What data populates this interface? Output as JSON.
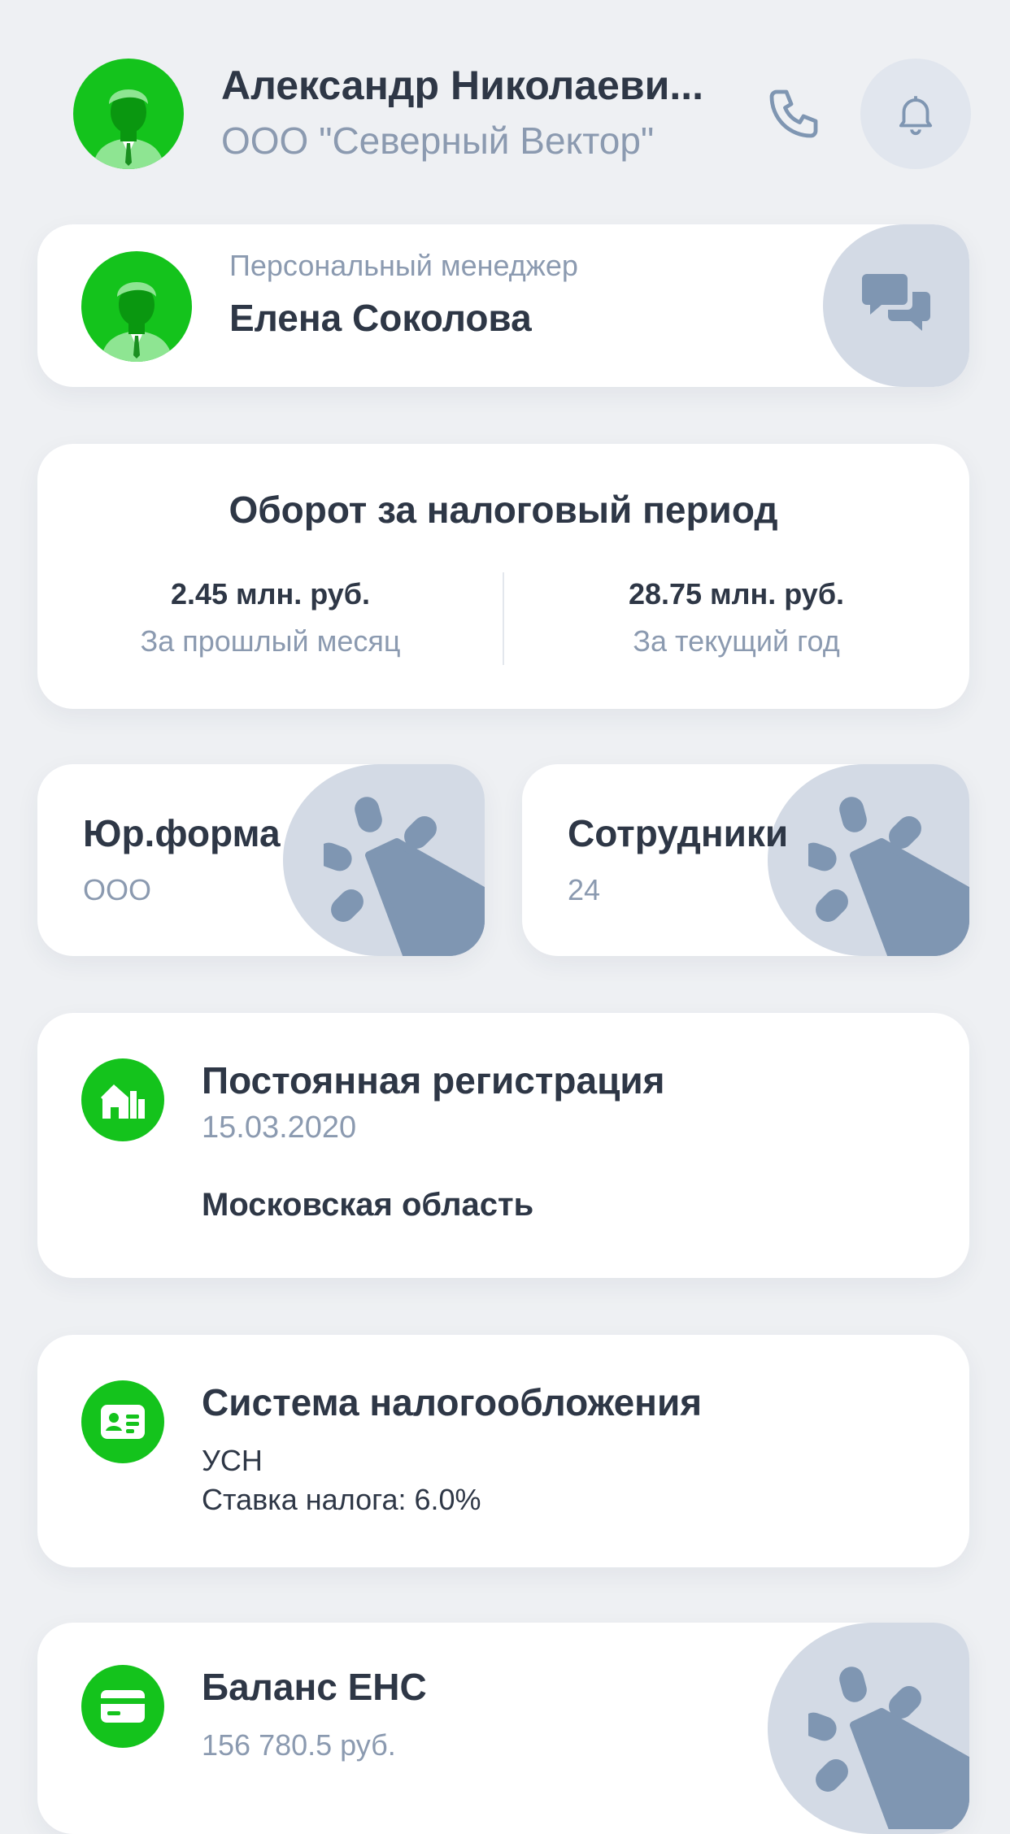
{
  "header": {
    "user_name": "Александр Николаеви...",
    "company": "ООО \"Северный Вектор\""
  },
  "manager": {
    "label": "Персональный менеджер",
    "name": "Елена Соколова"
  },
  "turnover": {
    "title": "Оборот за налоговый период",
    "last_month_value": "2.45 млн. руб.",
    "last_month_label": "За прошлый месяц",
    "year_value": "28.75 млн. руб.",
    "year_label": "За текущий год"
  },
  "legal_form": {
    "title": "Юр.форма",
    "value": "ООО"
  },
  "employees": {
    "title": "Сотрудники",
    "value": "24"
  },
  "registration": {
    "title": "Постоянная регистрация",
    "date": "15.03.2020",
    "region": "Московская область"
  },
  "tax_system": {
    "title": "Система налогообложения",
    "type": "УСН",
    "rate": "Ставка налога: 6.0%"
  },
  "ens_balance": {
    "title": "Баланс ЕНС",
    "value": "156 780.5 руб."
  },
  "colors": {
    "accent_green": "#14c31c",
    "text_dark": "#2e3746",
    "text_muted": "#8b9ab0",
    "blob_gray": "#d3dae5",
    "icon_slate": "#7f96b2"
  }
}
